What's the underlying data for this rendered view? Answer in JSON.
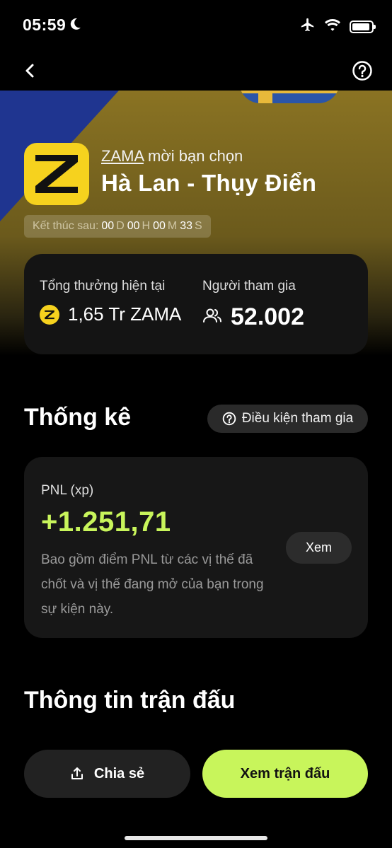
{
  "status_bar": {
    "time": "05:59",
    "icons": [
      "moon-icon",
      "airplane-icon",
      "wifi-icon",
      "battery-icon"
    ]
  },
  "nav": {
    "back_icon": "chevron-left-icon",
    "help_icon": "question-circle-icon"
  },
  "hero": {
    "inviter": "ZAMA",
    "inviter_suffix": " mời bạn chọn",
    "match_title": "Hà Lan - Thụy Điển",
    "logo_letter": "Z",
    "countdown": {
      "label": "Kết thúc sau:",
      "days": "00",
      "days_unit": "D",
      "hours": "00",
      "hours_unit": "H",
      "minutes": "00",
      "minutes_unit": "M",
      "seconds": "33",
      "seconds_unit": "S"
    }
  },
  "prize": {
    "total_label": "Tổng thưởng hiện tại",
    "total_value": "1,65 Tr ZAMA",
    "participants_label": "Người tham gia",
    "participants_value": "52.002"
  },
  "stats": {
    "title": "Thống kê",
    "conditions_label": "Điều kiện tham gia",
    "pnl_label": "PNL (xp)",
    "pnl_value": "+1.251,71",
    "pnl_description": "Bao gồm điểm PNL từ các vị thế đã chốt và vị thế đang mở của bạn trong sự kiện này.",
    "view_label": "Xem"
  },
  "match_info": {
    "title": "Thông tin trận đấu"
  },
  "actions": {
    "share_label": "Chia sẻ",
    "view_match_label": "Xem trận đấu"
  },
  "colors": {
    "accent_green": "#c8f55b",
    "brand_yellow": "#f6d21e",
    "hero_gold": "#8a7323",
    "hero_blue": "#1f3590"
  }
}
